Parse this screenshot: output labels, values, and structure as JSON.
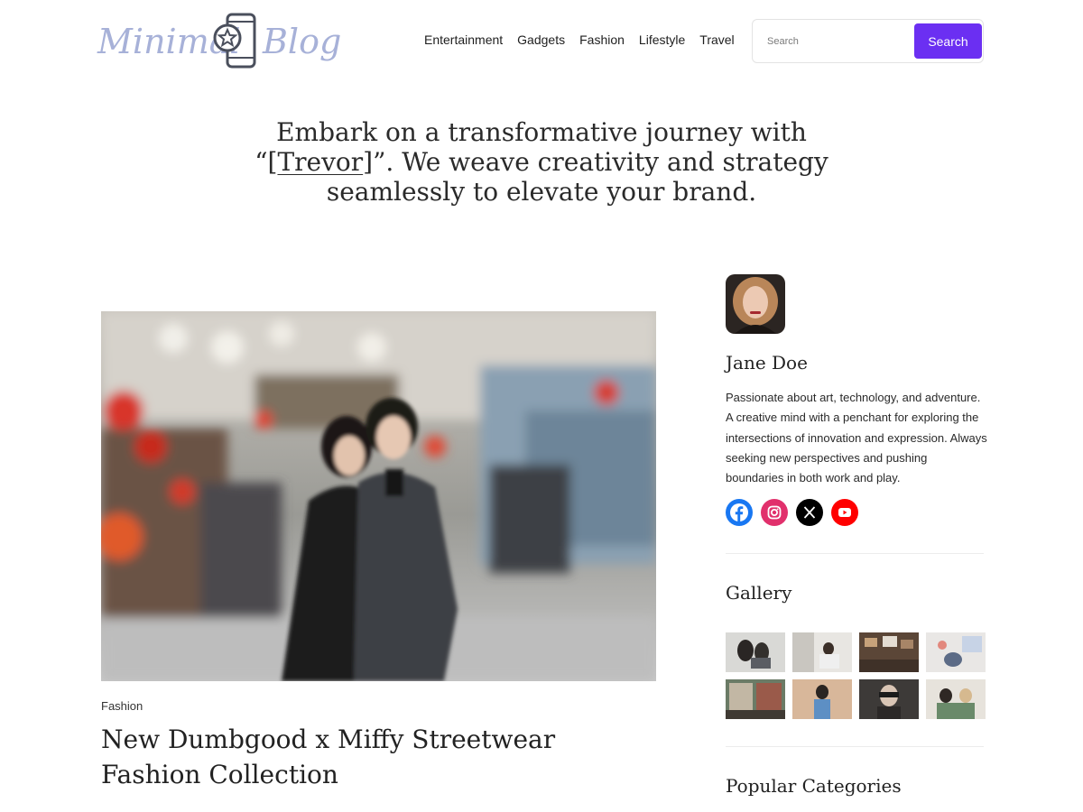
{
  "brand": {
    "logo_left": "Minimal",
    "logo_right": "Blog"
  },
  "nav": {
    "items": [
      "Entertainment",
      "Gadgets",
      "Fashion",
      "Lifestyle",
      "Travel"
    ]
  },
  "search": {
    "placeholder": "Search",
    "button_label": "Search"
  },
  "hero": {
    "line1": "Embark on a transformative journey with",
    "quote_open": "“[",
    "highlight": "Trevor",
    "quote_close": "]”. We weave creativity and strategy",
    "line3": "seamlessly to elevate your brand."
  },
  "post": {
    "category": "Fashion",
    "title": "New Dumbgood x Miffy Streetwear Fashion Collection"
  },
  "author": {
    "name": "Jane Doe",
    "bio": "Passionate about art, technology, and adventure. A creative mind with a penchant for exploring the intersections of innovation and expression. Always seeking new perspectives and pushing boundaries in both work and play."
  },
  "socials": [
    {
      "icon": "facebook-icon",
      "color": "#1877f2"
    },
    {
      "icon": "instagram-icon",
      "color": "#e1306c"
    },
    {
      "icon": "x-icon",
      "color": "#000000"
    },
    {
      "icon": "youtube-icon",
      "color": "#ff0000"
    }
  ],
  "sidebar": {
    "gallery_title": "Gallery",
    "popular_categories_title": "Popular Categories"
  },
  "colors": {
    "accent": "#6b2ff2",
    "logo": "#a7b1d8"
  }
}
